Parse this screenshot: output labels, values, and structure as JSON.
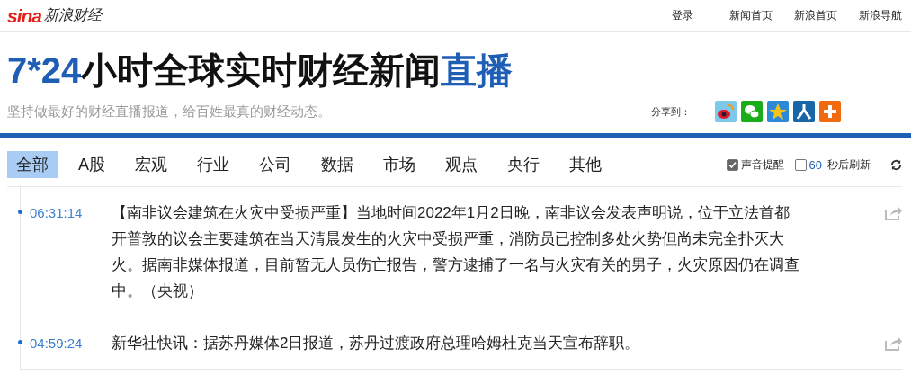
{
  "header": {
    "logo": "sina",
    "logo_text": "新浪财经",
    "nav": [
      "登录",
      "新闻首页",
      "新浪首页",
      "新浪导航"
    ]
  },
  "title": [
    {
      "text": "7*24",
      "accent": true
    },
    {
      "text": "小时全球实时财经新闻",
      "accent": false
    },
    {
      "text": "直播",
      "accent": true
    }
  ],
  "subtitle": "坚持做最好的财经直播报道，给百姓最真的财经动态。",
  "share": {
    "label": "分享到：",
    "targets": [
      {
        "kind": "weibo"
      },
      {
        "kind": "wechat"
      },
      {
        "kind": "qzone"
      },
      {
        "kind": "renren"
      },
      {
        "kind": "more"
      }
    ]
  },
  "tabs": [
    {
      "label": "全部",
      "selected": true
    },
    {
      "label": "A股",
      "selected": false
    },
    {
      "label": "宏观",
      "selected": false
    },
    {
      "label": "行业",
      "selected": false
    },
    {
      "label": "公司",
      "selected": false
    },
    {
      "label": "数据",
      "selected": false
    },
    {
      "label": "市场",
      "selected": false
    },
    {
      "label": "观点",
      "selected": false
    },
    {
      "label": "央行",
      "selected": false
    },
    {
      "label": "其他",
      "selected": false
    }
  ],
  "options": {
    "sound": {
      "label": "声音提醒",
      "checked": true
    },
    "refresh": {
      "seconds": "60",
      "label": "秒后刷新",
      "checked": false
    }
  },
  "feed": [
    {
      "time": "06:31:14",
      "text": "【南非议会建筑在火灾中受损严重】当地时间2022年1月2日晚，南非议会发表声明说，位于立法首都开普敦的议会主要建筑在当天清晨发生的火灾中受损严重，消防员已控制多处火势但尚未完全扑灭大火。据南非媒体报道，目前暂无人员伤亡报告，警方逮捕了一名与火灾有关的男子，火灾原因仍在调查中。（央视）"
    },
    {
      "time": "04:59:24",
      "text": "新华社快讯：据苏丹媒体2日报道，苏丹过渡政府总理哈姆杜克当天宣布辞职。"
    }
  ]
}
